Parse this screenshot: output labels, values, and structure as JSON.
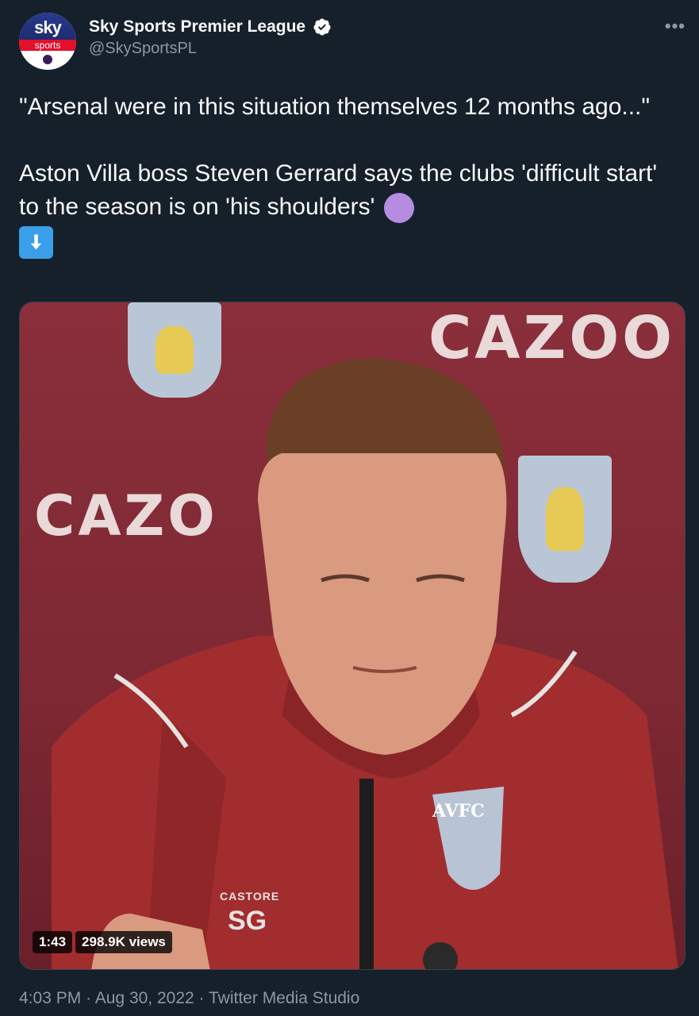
{
  "account": {
    "display_name": "Sky Sports Premier League",
    "handle": "@SkySportsPL",
    "avatar_sky": "sky",
    "avatar_sports": "sports",
    "verified_icon": "verified-badge-icon",
    "more_label": "•••"
  },
  "tweet": {
    "line1": "\"Arsenal were in this situation themselves 12 months ago...\"",
    "line2": "Aston Villa boss Steven Gerrard says the clubs 'difficult start' to the season is on 'his shoulders'",
    "emoji_circle": "purple-circle-emoji",
    "emoji_arrow": "down-arrow-emoji"
  },
  "media": {
    "sponsor_text_top": "CAZOO",
    "sponsor_text_left": "CAZO",
    "crest_text": "AVFC",
    "duration": "1:43",
    "views": "298.9K views",
    "kit_brand": "CASTORE",
    "kit_initials": "SG",
    "colors": {
      "backdrop": "#8a2f3b",
      "jacket": "#a12d2f"
    }
  },
  "meta": {
    "time": "4:03 PM",
    "separator": "·",
    "date": "Aug 30, 2022",
    "source": "Twitter Media Studio"
  },
  "theme": {
    "background": "#15202b",
    "text": "#f7f9f9",
    "secondary": "#8b98a5",
    "verified": "#ffffff"
  }
}
